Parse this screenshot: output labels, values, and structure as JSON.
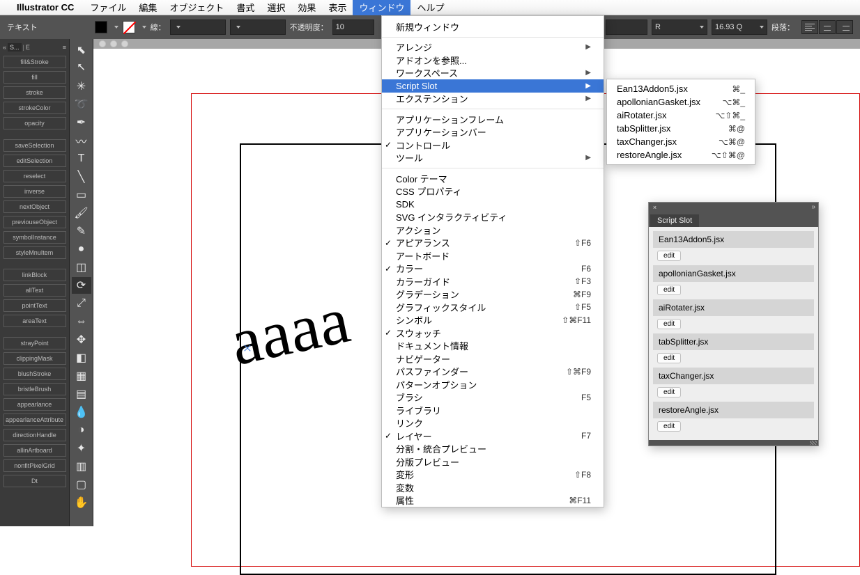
{
  "menubar": {
    "appname": "Illustrator CC",
    "items": [
      "ファイル",
      "編集",
      "オブジェクト",
      "書式",
      "選択",
      "効果",
      "表示",
      "ウィンドウ",
      "ヘルプ"
    ],
    "selected_index": 7
  },
  "controlbar": {
    "mode": "テキスト",
    "stroke_label": "線：",
    "opacity_label": "不透明度：",
    "opacity_value": "10",
    "style_letter": "R",
    "fontsize": "16.93 Q",
    "para_label": "段落："
  },
  "actions_tabrow": {
    "chev": "«",
    "tab1": "S...",
    "tab2": "E"
  },
  "actions": [
    "fill&Stroke",
    "fill",
    "stroke",
    "strokeColor",
    "opacity",
    "",
    "saveSelection",
    "editSelection",
    "reselect",
    "inverse",
    "nextObject",
    "previouseObject",
    "symbolInstance",
    "styleMnuItem",
    "",
    "linkBlock",
    "allText",
    "pointText",
    "areaText",
    "",
    "strayPoint",
    "clippingMask",
    "blushStroke",
    "bristleBrush",
    "appearlance",
    "appearlanceAttribute",
    "directionHandle",
    "allinArtboard",
    "nonfitPixelGrid",
    "Dt"
  ],
  "tools": [
    "arrow",
    "direct-select",
    "wand",
    "lasso",
    "pen",
    "curve",
    "type",
    "line",
    "rect",
    "brush",
    "pencil",
    "blob",
    "eraser",
    "rotate",
    "scale",
    "width",
    "free",
    "shape-builder",
    "mesh",
    "gradient",
    "eyedropper",
    "blend",
    "spray",
    "graph",
    "artboard",
    "hand"
  ],
  "tool_active": "rotate",
  "artwork_text": "aaaa",
  "dropdown": {
    "groups": [
      [
        {
          "label": "新規ウィンドウ"
        }
      ],
      [
        {
          "label": "アレンジ",
          "arrow": true
        },
        {
          "label": "アドオンを参照..."
        },
        {
          "label": "ワークスペース",
          "arrow": true
        },
        {
          "label": "Script Slot",
          "arrow": true,
          "highlight": true
        },
        {
          "label": "エクステンション",
          "arrow": true
        }
      ],
      [
        {
          "label": "アプリケーションフレーム"
        },
        {
          "label": "アプリケーションバー"
        },
        {
          "label": "コントロール",
          "check": true
        },
        {
          "label": "ツール",
          "arrow": true
        }
      ],
      [
        {
          "label": "Color テーマ"
        },
        {
          "label": "CSS プロパティ"
        },
        {
          "label": "SDK"
        },
        {
          "label": "SVG インタラクティビティ"
        },
        {
          "label": "アクション"
        },
        {
          "label": "アピアランス",
          "check": true,
          "short": "⇧F6"
        },
        {
          "label": "アートボード"
        },
        {
          "label": "カラー",
          "check": true,
          "short": "F6"
        },
        {
          "label": "カラーガイド",
          "short": "⇧F3"
        },
        {
          "label": "グラデーション",
          "short": "⌘F9"
        },
        {
          "label": "グラフィックスタイル",
          "short": "⇧F5"
        },
        {
          "label": "シンボル",
          "short": "⇧⌘F11"
        },
        {
          "label": "スウォッチ",
          "check": true
        },
        {
          "label": "ドキュメント情報"
        },
        {
          "label": "ナビゲーター"
        },
        {
          "label": "パスファインダー",
          "short": "⇧⌘F9"
        },
        {
          "label": "パターンオプション"
        },
        {
          "label": "ブラシ",
          "short": "F5"
        },
        {
          "label": "ライブラリ"
        },
        {
          "label": "リンク"
        },
        {
          "label": "レイヤー",
          "check": true,
          "short": "F7"
        },
        {
          "label": "分割・統合プレビュー"
        },
        {
          "label": "分版プレビュー"
        },
        {
          "label": "変形",
          "short": "⇧F8"
        },
        {
          "label": "変数"
        },
        {
          "label": "属性",
          "short": "⌘F11"
        }
      ]
    ]
  },
  "submenu": [
    {
      "label": "Ean13Addon5.jsx",
      "short": "⌘_"
    },
    {
      "label": "apollonianGasket.jsx",
      "short": "⌥⌘_"
    },
    {
      "label": "aiRotater.jsx",
      "short": "⌥⇧⌘_"
    },
    {
      "label": "tabSplitter.jsx",
      "short": "⌘@"
    },
    {
      "label": "taxChanger.jsx",
      "short": "⌥⌘@"
    },
    {
      "label": "restoreAngle.jsx",
      "short": "⌥⇧⌘@"
    }
  ],
  "panel": {
    "title": "Script Slot",
    "edit_label": "edit",
    "slots": [
      "Ean13Addon5.jsx",
      "apollonianGasket.jsx",
      "aiRotater.jsx",
      "tabSplitter.jsx",
      "taxChanger.jsx",
      "restoreAngle.jsx"
    ]
  }
}
